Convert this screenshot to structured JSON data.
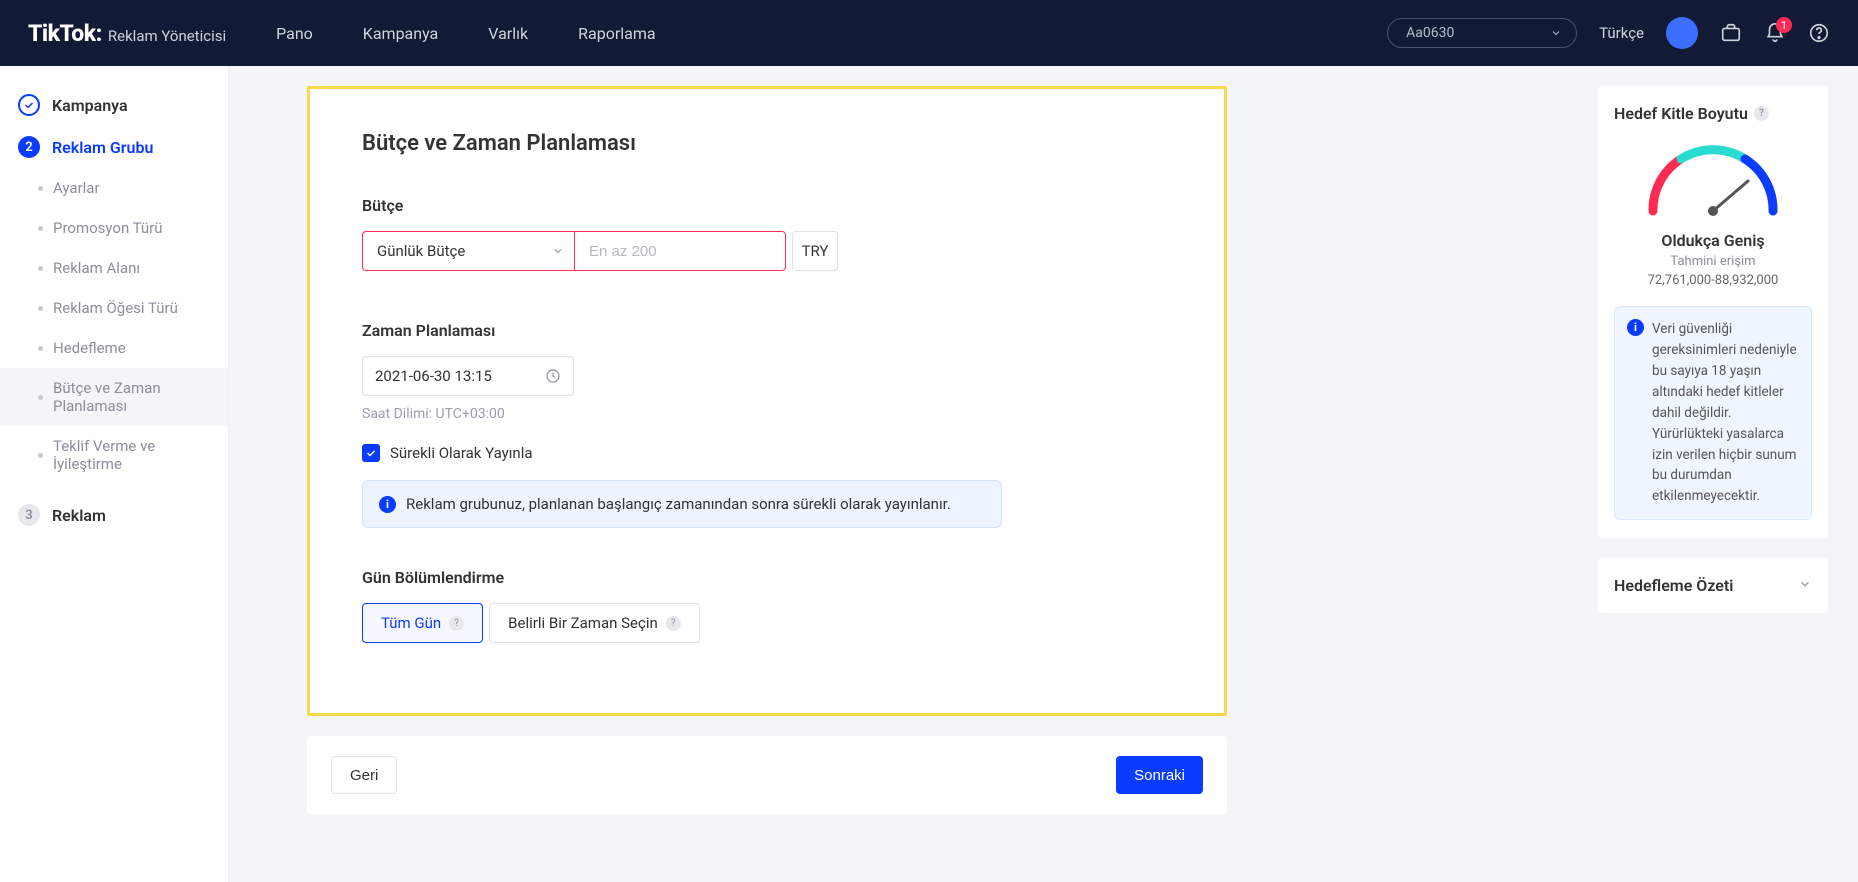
{
  "header": {
    "brand": "TikTok:",
    "brand_sub": "Reklam Yöneticisi",
    "nav": [
      "Pano",
      "Kampanya",
      "Varlık",
      "Raporlama"
    ],
    "account": "Aa0630",
    "language": "Türkçe",
    "notif_count": "1"
  },
  "sidebar": {
    "step1": "Kampanya",
    "step2": "Reklam Grubu",
    "step3": "Reklam",
    "subs": [
      "Ayarlar",
      "Promosyon Türü",
      "Reklam Alanı",
      "Reklam Öğesi Türü",
      "Hedefleme",
      "Bütçe ve Zaman Planlaması",
      "Teklif Verme ve İyileştirme"
    ]
  },
  "card": {
    "title": "Bütçe ve Zaman Planlaması",
    "budget_label": "Bütçe",
    "budget_type": "Günlük Bütçe",
    "budget_placeholder": "En az 200",
    "currency": "TRY",
    "schedule_label": "Zaman Planlaması",
    "datetime": "2021-06-30 13:15",
    "tz": "Saat Dilimi: UTC+03:00",
    "continuous": "Sürekli Olarak Yayınla",
    "info": "Reklam grubunuz, planlanan başlangıç zamanından sonra sürekli olarak yayınlanır.",
    "dayparting_label": "Gün Bölümlendirme",
    "seg_all": "Tüm Gün",
    "seg_pick": "Belirli Bir Zaman Seçin"
  },
  "footer": {
    "back": "Geri",
    "next": "Sonraki"
  },
  "right": {
    "audience_title": "Hedef Kitle Boyutu",
    "gauge_label": "Oldukça Geniş",
    "gauge_sub": "Tahmini erişim",
    "gauge_range": "72,761,000-88,932,000",
    "note": "Veri güvenliği gereksinimleri nedeniyle bu sayıya 18 yaşın altındaki hedef kitleler dahil değildir. Yürürlükteki yasalarca izin verilen hiçbir sunum bu durumdan etkilenmeyecektir.",
    "summary_title": "Hedefleme Özeti"
  }
}
